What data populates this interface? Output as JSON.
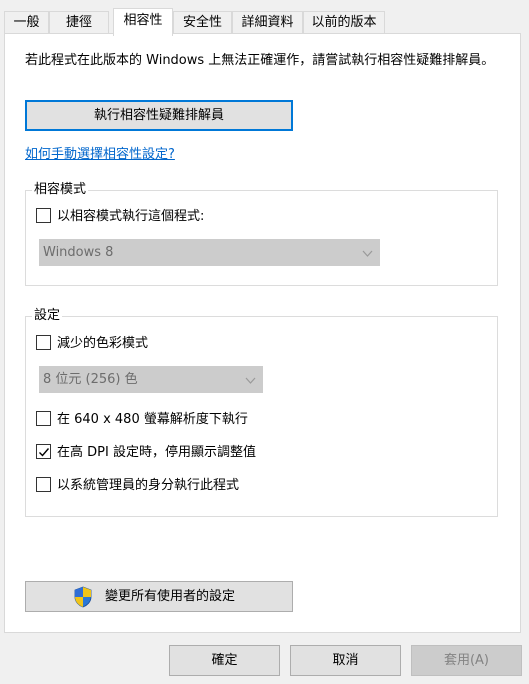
{
  "tabs": [
    {
      "label": "一般"
    },
    {
      "label": "捷徑"
    },
    {
      "label": "相容性",
      "active": true
    },
    {
      "label": "安全性"
    },
    {
      "label": "詳細資料"
    },
    {
      "label": "以前的版本"
    }
  ],
  "description": "若此程式在此版本的 Windows 上無法正確運作，請嘗試執行相容性疑難排解員。",
  "troubleshoot_button": "執行相容性疑難排解員",
  "manual_link": "如何手動選擇相容性設定?",
  "compat_mode": {
    "group_label": "相容模式",
    "checkbox_label": "以相容模式執行這個程式:",
    "checked": false,
    "os_select": "Windows 8"
  },
  "settings": {
    "group_label": "設定",
    "reduced_color": {
      "label": "減少的色彩模式",
      "checked": false
    },
    "color_select": "8 位元 (256) 色",
    "res_640": {
      "label": "在 640 x 480 螢幕解析度下執行",
      "checked": false
    },
    "high_dpi": {
      "label": "在高 DPI 設定時，停用顯示調整值",
      "checked": true
    },
    "run_admin": {
      "label": "以系統管理員的身分執行此程式",
      "checked": false
    }
  },
  "all_users_button": "變更所有使用者的設定",
  "footer": {
    "ok": "確定",
    "cancel": "取消",
    "apply": "套用(A)"
  },
  "icons": {
    "dropdown": "chevron-down-icon",
    "checkmark": "checkmark-icon",
    "uac": "uac-shield-icon"
  },
  "colors": {
    "focus_border": "#0078d7",
    "link": "#0066cc",
    "disabled_fill": "#cccccc"
  }
}
